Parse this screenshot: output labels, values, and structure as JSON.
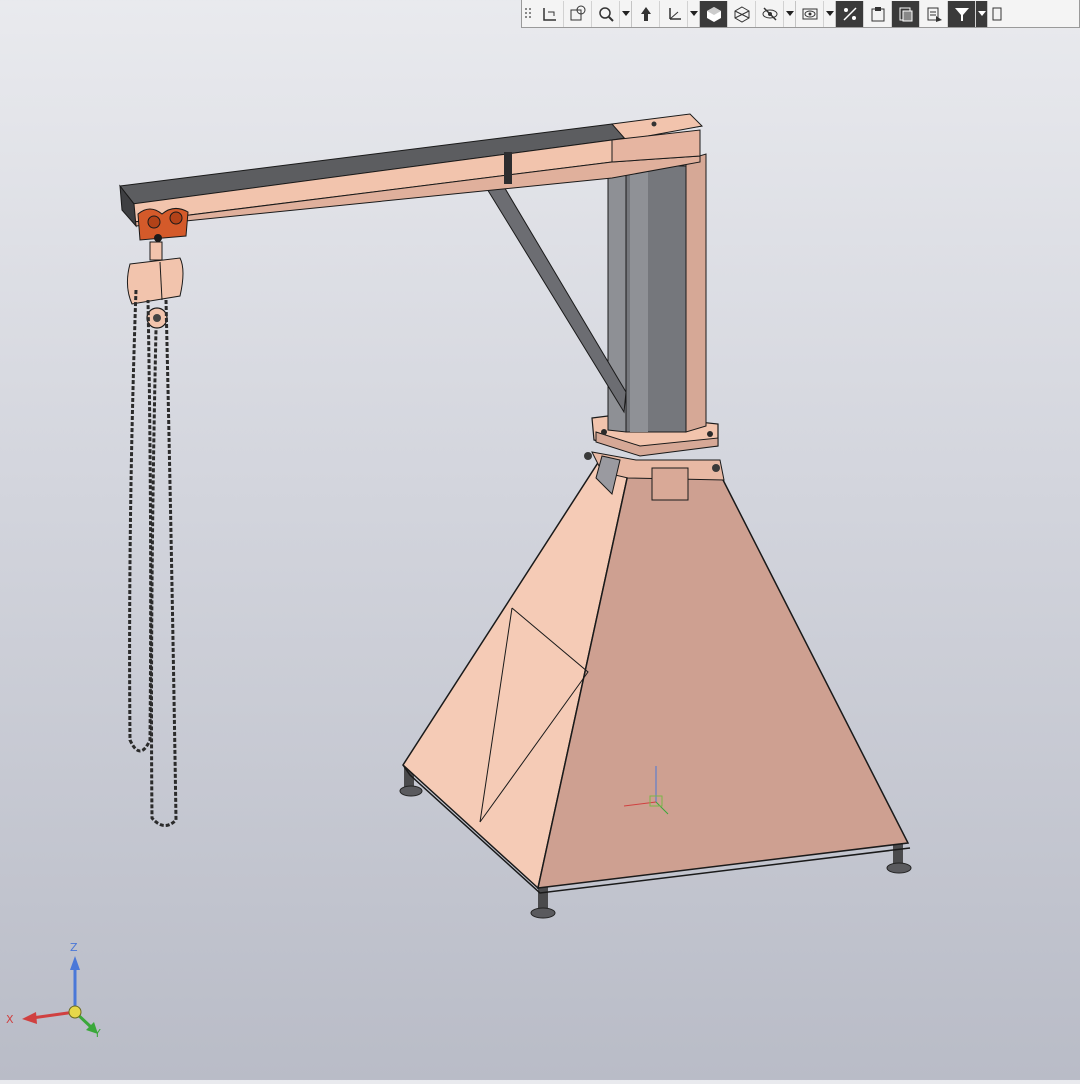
{
  "toolbar": {
    "items": [
      {
        "name": "grip-icon",
        "dropdown": false,
        "dark": false
      },
      {
        "name": "sketch-plane-icon",
        "dropdown": false,
        "dark": false
      },
      {
        "name": "zoom-to-fit-icon",
        "dropdown": false,
        "dark": false
      },
      {
        "name": "zoom-icon",
        "dropdown": true,
        "dark": false
      },
      {
        "name": "orient-icon",
        "dropdown": false,
        "dark": false
      },
      {
        "name": "coordinate-system-icon",
        "dropdown": true,
        "dark": false
      },
      {
        "name": "shaded-view-icon",
        "dropdown": false,
        "dark": true
      },
      {
        "name": "wireframe-view-icon",
        "dropdown": false,
        "dark": false
      },
      {
        "name": "hide-icon",
        "dropdown": true,
        "dark": false
      },
      {
        "name": "show-icon",
        "dropdown": true,
        "dark": false
      },
      {
        "name": "constraints-icon",
        "dropdown": false,
        "dark": true
      },
      {
        "name": "section-icon",
        "dropdown": false,
        "dark": false
      },
      {
        "name": "layers-icon",
        "dropdown": false,
        "dark": true
      },
      {
        "name": "properties-icon",
        "dropdown": false,
        "dark": false
      },
      {
        "name": "filter-icon",
        "dropdown": true,
        "dark": true
      },
      {
        "name": "more-icon",
        "dropdown": false,
        "dark": false
      }
    ]
  },
  "triad": {
    "x_label": "X",
    "y_label": "Y",
    "z_label": "Z"
  },
  "colors": {
    "part": "#f2c4ad",
    "part_shade": "#c9a093",
    "steel_dark": "#5c5d60",
    "trolley": "#d45a2a",
    "chain": "#2b2b2b"
  }
}
